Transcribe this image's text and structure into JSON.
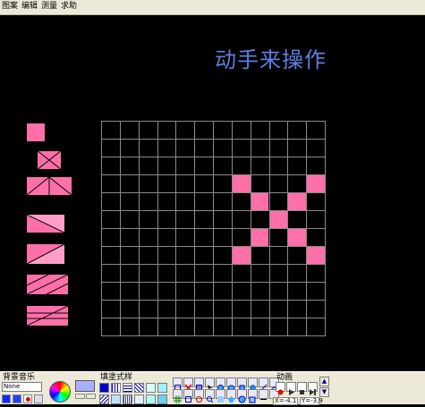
{
  "menu": {
    "items": [
      {
        "label": "图案"
      },
      {
        "label": "编辑"
      },
      {
        "label": "测量"
      },
      {
        "label": "求助"
      }
    ]
  },
  "canvas": {
    "headline": "动手来操作",
    "fill_color": "#ff6fa8",
    "grid_color": "#8a8a8a",
    "grid": {
      "columns": 12,
      "rows": 12,
      "filled_cells": [
        [
          7,
          3
        ],
        [
          11,
          3
        ],
        [
          8,
          4
        ],
        [
          10,
          4
        ],
        [
          9,
          5
        ],
        [
          8,
          6
        ],
        [
          10,
          6
        ],
        [
          7,
          7
        ],
        [
          11,
          7
        ]
      ]
    },
    "palette_tiles": [
      {
        "name": "solid-square"
      },
      {
        "name": "square-with-x"
      },
      {
        "name": "two-triangles"
      },
      {
        "name": "wide-triangle-top"
      },
      {
        "name": "wide-triangle-diagonal"
      },
      {
        "name": "wide-triangle-double"
      },
      {
        "name": "wide-triangle-cross"
      }
    ]
  },
  "toolbar": {
    "bg_music_label": "背景音乐",
    "bg_music_value": "None",
    "fill_style_label": "填塗式样",
    "animation_label": "动画",
    "coord_x": "X=-4.1",
    "coord_y": "Y=-3.9",
    "swatch_color": "#aab0ff"
  }
}
